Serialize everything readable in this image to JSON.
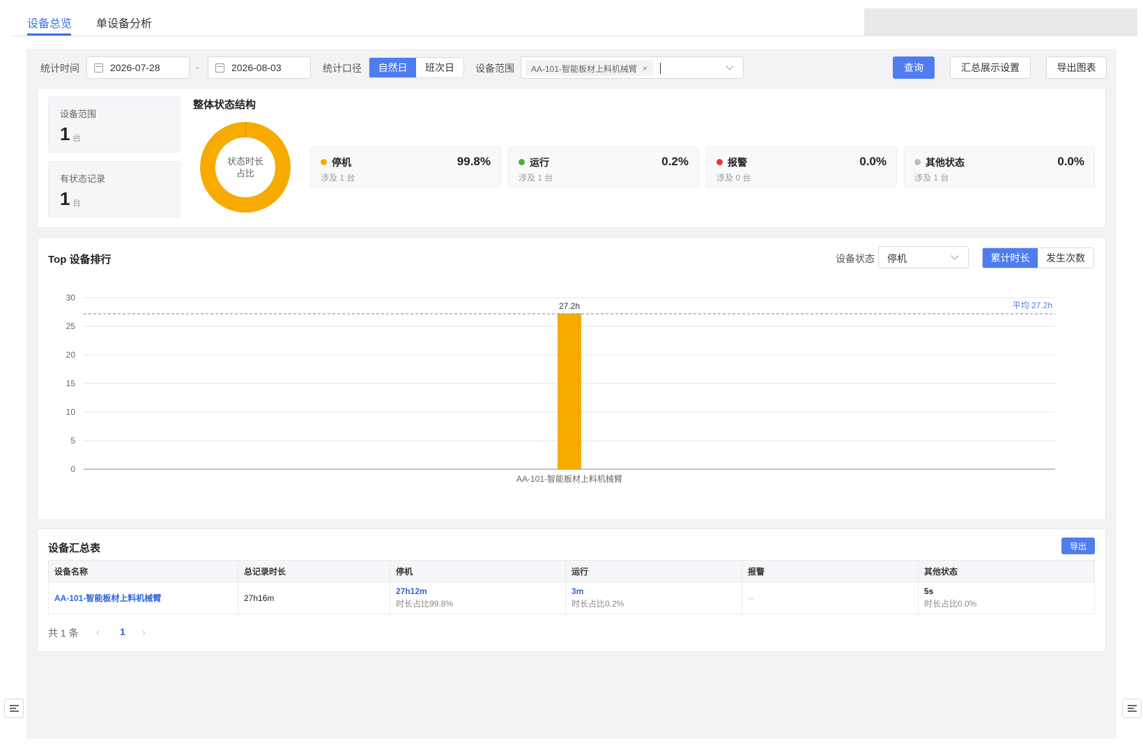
{
  "tabs": [
    {
      "label": "设备总览",
      "active": true
    },
    {
      "label": "单设备分析",
      "active": false
    }
  ],
  "filters": {
    "time_label": "统计时间",
    "start_date": "2026-07-28",
    "separator": "-",
    "end_date": "2026-08-03",
    "caliber_label": "统计口径",
    "caliber_options": [
      "自然日",
      "班次日"
    ],
    "caliber_selected": "自然日",
    "scope_label": "设备范围",
    "scope_tag": "AA-101-智能板材上料机械臂",
    "scope_tag_close": "×",
    "query_button": "查询",
    "summary_button": "汇总展示设置",
    "export_chart_button": "导出图表"
  },
  "overview": {
    "scope_card": {
      "label": "设备范围",
      "value": "1",
      "unit": "台"
    },
    "record_card": {
      "label": "有状态记录",
      "value": "1",
      "unit": "台"
    },
    "structure_title": "整体状态结构",
    "donut_center_line1": "状态时长",
    "donut_center_line2": "占比",
    "status_cards": [
      {
        "name": "停机",
        "percent": "99.8%",
        "sub": "涉及 1 台",
        "color": "#f7ab00"
      },
      {
        "name": "运行",
        "percent": "0.2%",
        "sub": "涉及 1 台",
        "color": "#4caf3a"
      },
      {
        "name": "报警",
        "percent": "0.0%",
        "sub": "涉及 0 台",
        "color": "#e53935"
      },
      {
        "name": "其他状态",
        "percent": "0.0%",
        "sub": "涉及 1 台",
        "color": "#bdbdbd"
      }
    ]
  },
  "ranking": {
    "title": "Top 设备排行",
    "status_label": "设备状态",
    "status_selected": "停机",
    "metric_options": [
      "累计时长",
      "发生次数"
    ],
    "metric_selected": "累计时长"
  },
  "chart_data": {
    "type": "bar",
    "categories": [
      "AA-101-智能板材上料机械臂"
    ],
    "values": [
      27.2
    ],
    "data_labels": [
      "27.2h"
    ],
    "ylim": [
      0,
      30
    ],
    "yticks": [
      0,
      5,
      10,
      15,
      20,
      25,
      30
    ],
    "average": 27.2,
    "average_label": "平均 27.2h",
    "bar_color": "#f7ab00",
    "avg_line_color": "#4f7df0",
    "grid": true
  },
  "table": {
    "title": "设备汇总表",
    "export_button": "导出",
    "columns": [
      "设备名称",
      "总记录时长",
      "停机",
      "运行",
      "报警",
      "其他状态"
    ],
    "rows": [
      {
        "name": "AA-101-智能板材上料机械臂",
        "total": "27h16m",
        "stop": {
          "main": "27h12m",
          "sub": "时长占比99.8%"
        },
        "run": {
          "main": "3m",
          "sub": "时长占比0.2%"
        },
        "alarm": "--",
        "other": {
          "main": "5s",
          "sub": "时长占比0.0%"
        }
      }
    ],
    "total_text": "共 1 条",
    "prev_arrow": "‹",
    "current_page": "1",
    "next_arrow": "›"
  }
}
